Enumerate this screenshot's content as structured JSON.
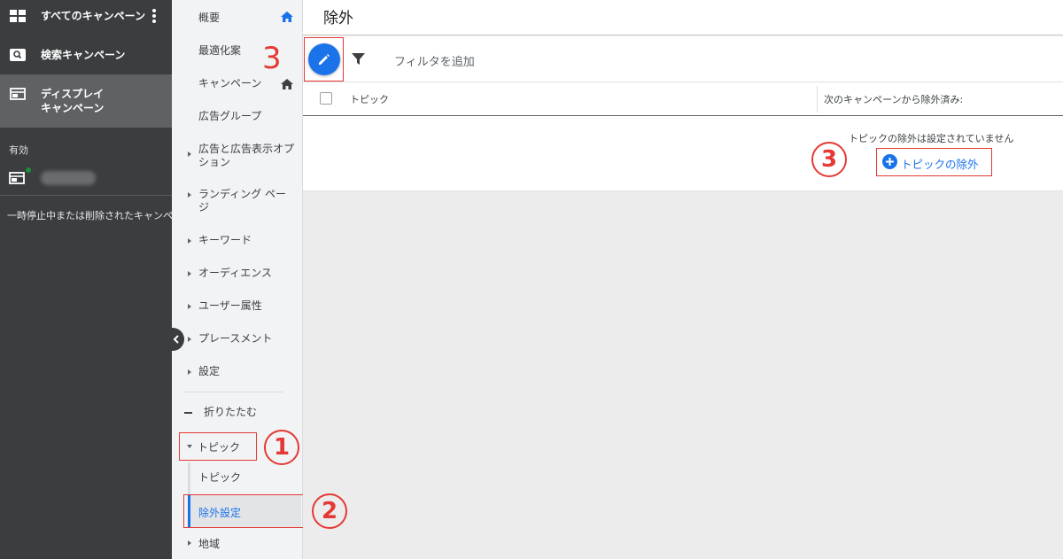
{
  "left_nav": {
    "all_campaigns": "すべてのキャンペーン",
    "search_campaigns": "検索キャンペーン",
    "display_campaigns_line1": "ディスプレイ",
    "display_campaigns_line2": "キャンペーン",
    "status_label": "有効",
    "paused_label": "一時停止中または削除されたキャンペーン"
  },
  "page_menu": {
    "items": [
      {
        "label": "概要"
      },
      {
        "label": "最適化案"
      },
      {
        "label": "キャンペーン"
      },
      {
        "label": "広告グループ"
      },
      {
        "label": "広告と広告表示オプション"
      },
      {
        "label": "ランディング ページ"
      },
      {
        "label": "キーワード"
      },
      {
        "label": "オーディエンス"
      },
      {
        "label": "ユーザー属性"
      },
      {
        "label": "プレースメント"
      },
      {
        "label": "設定"
      }
    ],
    "collapse_label": "折りたたむ",
    "topic_group": "トピック",
    "topic_sub": "トピック",
    "exclusion_sub": "除外設定",
    "region": "地域"
  },
  "main": {
    "title": "除外",
    "filter_placeholder": "フィルタを追加",
    "columns": {
      "topic": "トピック",
      "excluded_from": "次のキャンペーンから除外済み:"
    },
    "empty_message": "トピックの除外は設定されていません",
    "add_exclusion": "トピックの除外"
  },
  "annotations": {
    "step1": "1",
    "step2": "2",
    "step3_toolbar": "3",
    "step3_content": "3"
  },
  "colors": {
    "accent": "#1a73e8",
    "annotation": "#e53935",
    "sidebar": "#3b3d3f"
  }
}
